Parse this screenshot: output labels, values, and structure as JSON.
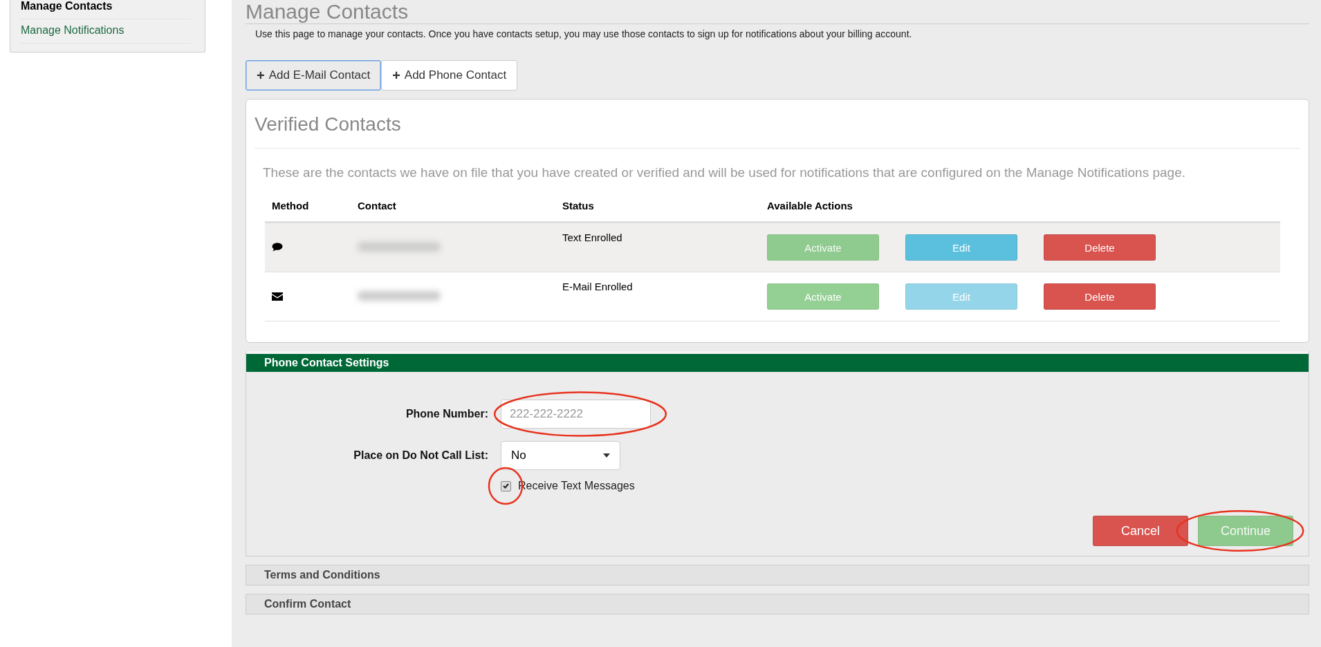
{
  "sidebar": {
    "items": [
      {
        "label": "Manage Contacts",
        "selected": true
      },
      {
        "label": "Manage Notifications",
        "selected": false
      }
    ]
  },
  "page": {
    "title": "Manage Contacts",
    "intro": "Use this page to manage your contacts. Once you have contacts setup, you may use those contacts to sign up for notifications about your billing account.",
    "add_buttons": [
      {
        "icon": "+",
        "label": "Add E-Mail Contact",
        "selected": true
      },
      {
        "icon": "+",
        "label": "Add Phone Contact",
        "selected": false
      }
    ]
  },
  "verified": {
    "title": "Verified Contacts",
    "description": "These are the contacts we have on file that you have created or verified and will be used for notifications that are configured on the Manage Notifications page.",
    "columns": [
      "Method",
      "Contact",
      "Status",
      "Available Actions"
    ],
    "rows": [
      {
        "kind": "text",
        "status": "Text Enrolled",
        "highlighted": true,
        "actions": [
          {
            "kind": "activate",
            "label": "Activate",
            "disabled": true
          },
          {
            "kind": "edit",
            "label": "Edit",
            "disabled": false
          },
          {
            "kind": "delete",
            "label": "Delete",
            "disabled": false
          }
        ]
      },
      {
        "kind": "email",
        "status": "E-Mail Enrolled",
        "highlighted": false,
        "actions": [
          {
            "kind": "activate",
            "label": "Activate",
            "disabled": true
          },
          {
            "kind": "edit",
            "label": "Edit",
            "disabled": true
          },
          {
            "kind": "delete",
            "label": "Delete",
            "disabled": false
          }
        ]
      }
    ]
  },
  "phone_settings": {
    "title": "Phone Contact Settings",
    "phone": {
      "label": "Phone Number:",
      "placeholder": "222-222-2222",
      "circled": true
    },
    "dnc": {
      "label": "Place on Do Not Call List:",
      "value": "No"
    },
    "receive_text": {
      "label": "Receive Text Messages",
      "checked": true,
      "circled": true
    },
    "buttons": [
      {
        "kind": "cancel",
        "label": "Cancel",
        "disabled": false,
        "circled": false
      },
      {
        "kind": "continue",
        "label": "Continue",
        "disabled": true,
        "circled": true
      }
    ]
  },
  "collapsed_sections": [
    {
      "title": "Terms and Conditions"
    },
    {
      "title": "Confirm Contact"
    }
  ]
}
